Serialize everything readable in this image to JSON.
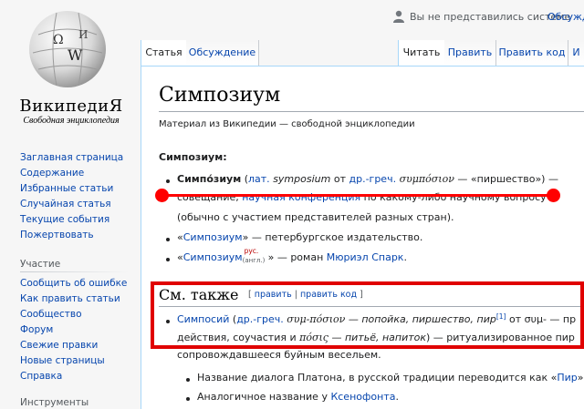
{
  "header": {
    "not_logged_in": "Вы не представились системе",
    "discussion_link": "Обсужд"
  },
  "logo": {
    "title": "ВикипедиЯ",
    "subtitle": "Свободная энциклопедия",
    "globe_letters": [
      "Ω",
      "W",
      "И"
    ]
  },
  "sidebar": {
    "main_items": [
      "Заглавная страница",
      "Содержание",
      "Избранные статьи",
      "Случайная статья",
      "Текущие события",
      "Пожертвовать"
    ],
    "participation_title": "Участие",
    "participation_items": [
      "Сообщить об ошибке",
      "Как править статьи",
      "Сообщество",
      "Форум",
      "Свежие правки",
      "Новые страницы",
      "Справка"
    ],
    "tools_title": "Инструменты"
  },
  "tabs": {
    "article": "Статья",
    "talk": "Обсуждение",
    "read": "Читать",
    "edit": "Править",
    "edit_source": "Править код",
    "history": "И"
  },
  "article": {
    "title": "Симпозиум",
    "tagline": "Материал из Википедии — свободной энциклопедии",
    "term_heading": "Симпозиум:",
    "item1": {
      "term": "Симпо́зиум",
      "open_paren": " (",
      "lat": "лат.",
      "latin_word": "symposium",
      "from": " от ",
      "greek_abbr": "др.-греч.",
      "greek_word": "συμπόσιον",
      "meaning": " — «пиршество») —",
      "line2_a": "совещание, ",
      "line2_link": "научная конференция",
      "line2_b": " по какому-либо научному вопросу",
      "line3": "(обычно с участием представителей разных стран)."
    },
    "item2": {
      "q_open": "«",
      "link": "Симпозиум",
      "rest": "» — петербургское издательство."
    },
    "item3": {
      "q_open": "«",
      "link": "Симпозиум",
      "sup": "рус.",
      "sub": "(англ.)",
      "rest_a": "» — роман ",
      "author": "Мюриэл Спарк",
      "rest_b": "."
    },
    "see_also": {
      "heading": "См. также",
      "edit_open": "[ ",
      "edit": "править",
      "sep": " | ",
      "edit_code": "править код",
      "edit_close": " ]"
    },
    "sa_item1": {
      "link": "Симпосий",
      "open": " (",
      "greek_abbr": "др.-греч.",
      "greek_word": " συμ-πόσιον",
      "meaning": " — попойка, пиршество, пир",
      "ref": "[1]",
      "rest": " от συμ- — пр",
      "line2_a": "действия, соучастия и ",
      "line2_greek": "πόσις",
      "line2_b": " — питьё, напиток",
      "line2_c": ") — ритуализированное пир",
      "line3": "сопровождавшееся буйным весельем."
    },
    "sa_item2": {
      "text": "Название диалога Платона, в русской традиции переводится как «",
      "link": "Пир",
      "end": "»."
    },
    "sa_item3": {
      "text": "Аналогичное название у ",
      "link": "Ксенофонта",
      "end": "."
    }
  },
  "colors": {
    "link": "#0645ad",
    "annotation": "#ff0000",
    "content_border": "#a7d7f9"
  }
}
